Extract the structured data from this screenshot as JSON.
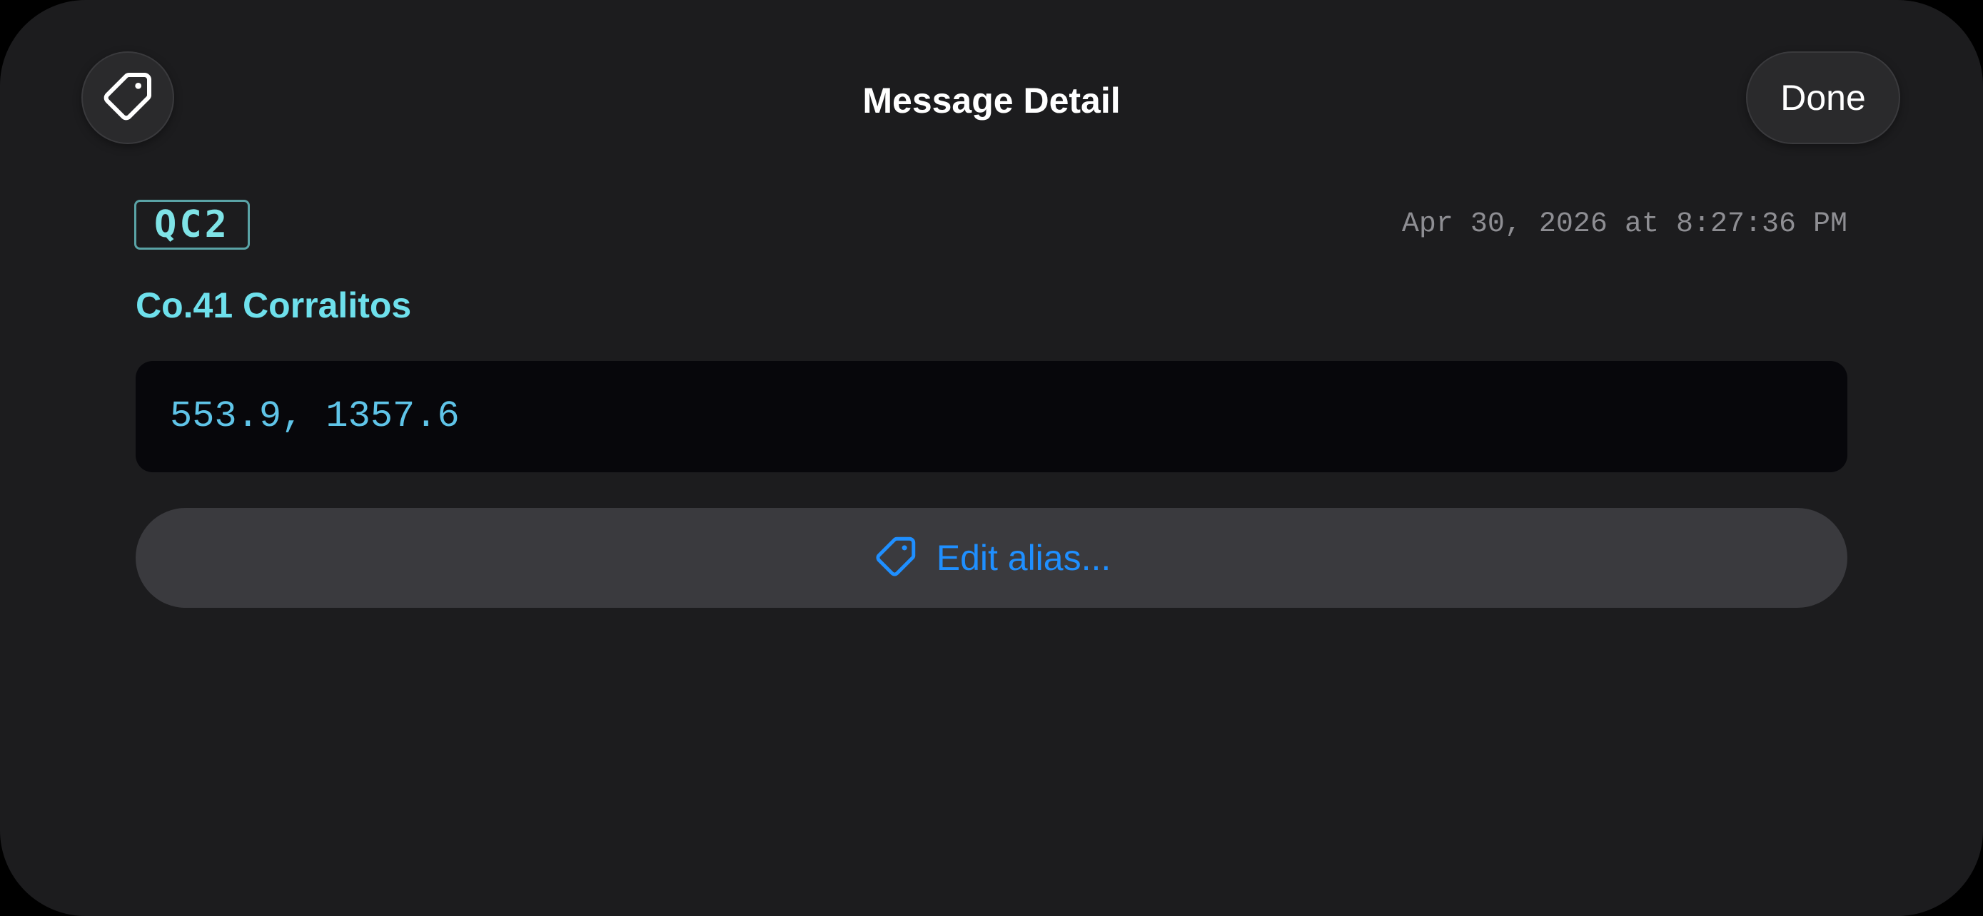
{
  "header": {
    "title": "Message Detail",
    "done_label": "Done",
    "left_icon": "tag-icon"
  },
  "message": {
    "badge": "QC2",
    "timestamp": "Apr 30, 2026 at 8:27:36 PM",
    "alias": "Co.41 Corralitos",
    "payload": "553.9, 1357.6"
  },
  "actions": {
    "edit_alias_label": "Edit alias...",
    "edit_alias_icon": "tag-icon"
  },
  "colors": {
    "background": "#1c1c1e",
    "alias_cyan": "#6ee0ec",
    "payload_text": "#5fc4e8",
    "accent_blue": "#1f8fff",
    "badge_border": "#5aa3a6"
  }
}
